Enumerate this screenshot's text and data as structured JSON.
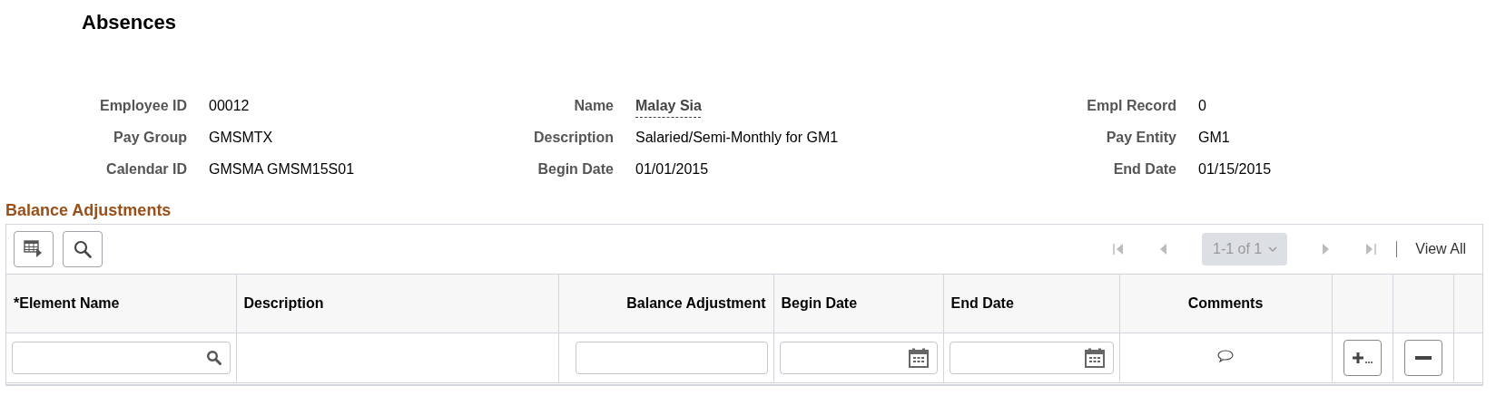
{
  "page": {
    "title": "Absences"
  },
  "header_fields": [
    {
      "label": "Employee ID",
      "value": "00012",
      "kind": "text"
    },
    {
      "label": "Name",
      "value": "Malay Sia",
      "kind": "link"
    },
    {
      "label": "Empl Record",
      "value": "0",
      "kind": "text"
    },
    {
      "label": "Pay Group",
      "value": "GMSMTX",
      "kind": "text"
    },
    {
      "label": "Description",
      "value": "Salaried/Semi-Monthly for GM1",
      "kind": "text"
    },
    {
      "label": "Pay Entity",
      "value": "GM1",
      "kind": "text"
    },
    {
      "label": "Calendar ID",
      "value": "GMSMA GMSM15S01",
      "kind": "text"
    },
    {
      "label": "Begin Date",
      "value": "01/01/2015",
      "kind": "text"
    },
    {
      "label": "End Date",
      "value": "01/15/2015",
      "kind": "text"
    }
  ],
  "grid": {
    "title": "Balance Adjustments",
    "pager": {
      "range": "1-1 of 1",
      "disabled": true,
      "view_all": "View All"
    },
    "columns": [
      {
        "label": "*Element Name"
      },
      {
        "label": "Description"
      },
      {
        "label": "Balance Adjustment"
      },
      {
        "label": "Begin Date"
      },
      {
        "label": "End Date"
      },
      {
        "label": "Comments"
      }
    ],
    "rows": [
      {
        "cells": [
          {
            "kind": "lookup"
          },
          {
            "kind": "blank"
          },
          {
            "kind": "input"
          },
          {
            "kind": "date"
          },
          {
            "kind": "date"
          },
          {
            "kind": "comment"
          },
          {
            "kind": "add"
          },
          {
            "kind": "delete"
          },
          {
            "kind": "blank"
          }
        ]
      }
    ]
  }
}
